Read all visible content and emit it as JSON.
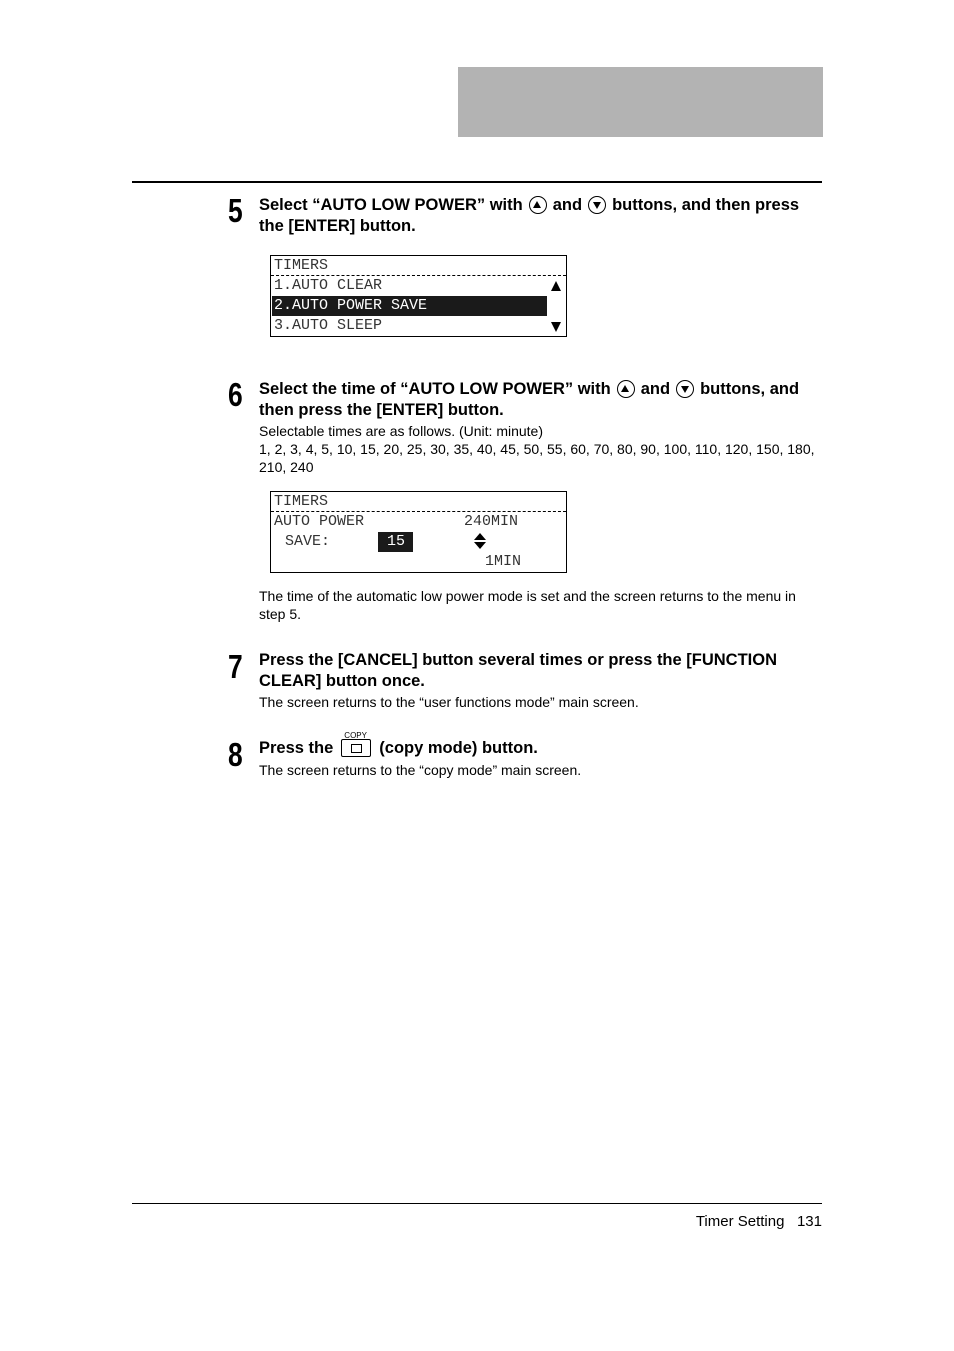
{
  "step5": {
    "number": "5",
    "head_a": "Select “AUTO LOW POWER” with",
    "and": "and",
    "head_b": "buttons, and then press the [ENTER] button.",
    "lcd": {
      "title": "TIMERS",
      "items": [
        "1.AUTO CLEAR",
        "2.AUTO POWER SAVE",
        "3.AUTO SLEEP"
      ],
      "selected_index": 1
    }
  },
  "step6": {
    "number": "6",
    "head_a": "Select the time of “AUTO LOW POWER” with",
    "and": "and",
    "head_b": "buttons, and then press the [ENTER] button.",
    "note": "Selectable times are as follows. (Unit: minute)",
    "times": "1, 2, 3, 4, 5, 10, 15, 20, 25, 30, 35, 40, 45, 50, 55, 60, 70, 80, 90, 100, 110, 120, 150, 180, 210, 240",
    "lcd": {
      "title": "TIMERS",
      "label1": "AUTO POWER",
      "label2": " SAVE:",
      "value": " 15",
      "max": "240MIN",
      "min": "1MIN"
    },
    "after": "The time of the automatic low power mode is set and the screen returns to the menu in step 5."
  },
  "step7": {
    "number": "7",
    "head": "Press the [CANCEL] button several times or press the [FUNCTION CLEAR] button once.",
    "body": "The screen returns to the “user functions mode” main screen."
  },
  "step8": {
    "number": "8",
    "head_a": "Press the",
    "key_label": "COPY",
    "head_b": "(copy mode) button.",
    "body": "The screen returns to the “copy mode” main screen."
  },
  "footer": {
    "section": "Timer Setting",
    "page": "131"
  }
}
